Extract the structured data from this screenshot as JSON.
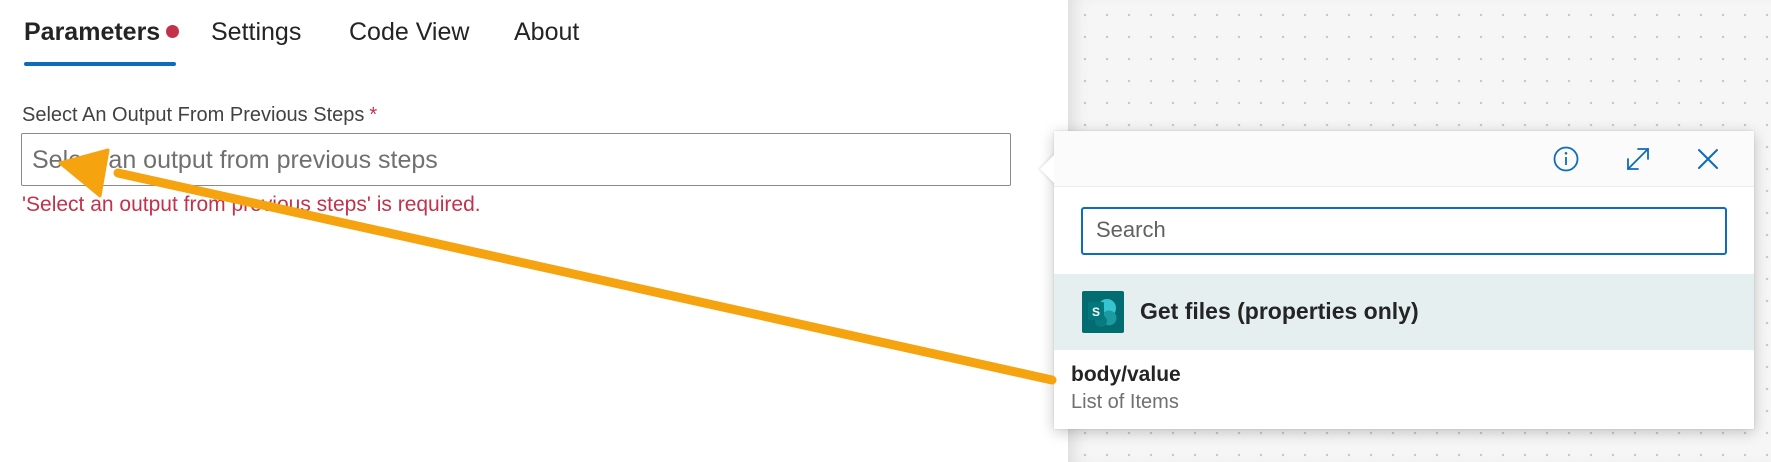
{
  "tabs": [
    {
      "label": "Parameters",
      "active": true,
      "has_error": true
    },
    {
      "label": "Settings",
      "active": false
    },
    {
      "label": "Code View",
      "active": false
    },
    {
      "label": "About",
      "active": false
    }
  ],
  "field": {
    "label": "Select An Output From Previous Steps",
    "required_mark": "*",
    "placeholder": "Select an output from previous steps",
    "error": "'Select an output from previous steps' is required."
  },
  "popup": {
    "header_icons": [
      "info-icon",
      "expand-icon",
      "close-icon"
    ],
    "search_placeholder": "Search",
    "group": {
      "title": "Get files (properties only)",
      "icon": "sharepoint-icon",
      "icon_letter": "S"
    },
    "items": [
      {
        "title": "body/value",
        "description": "List of Items"
      }
    ]
  },
  "colors": {
    "accent": "#0f6cbd",
    "error": "#c4314b",
    "annotation_arrow": "#f5a30f",
    "sharepoint": "#036c70"
  }
}
